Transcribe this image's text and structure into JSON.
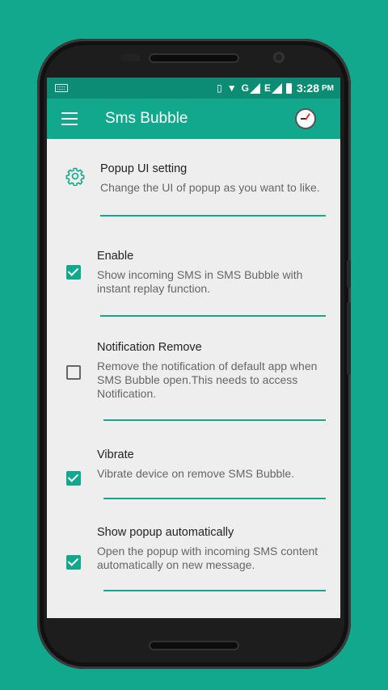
{
  "status_bar": {
    "time": "3:28",
    "ampm": "PM",
    "network_g": "G",
    "network_e": "E",
    "icons": [
      "keyboard-icon",
      "vibrate-icon",
      "wifi-icon",
      "signal-icon",
      "battery-icon"
    ]
  },
  "app_bar": {
    "title": "Sms Bubble",
    "menu_icon": "hamburger-menu-icon",
    "action_icon": "clock-icon"
  },
  "settings": {
    "popup_ui": {
      "title": "Popup UI setting",
      "description": "Change the UI of popup as you want to like.",
      "icon": "gear-icon"
    },
    "enable": {
      "title": "Enable",
      "description": "Show incoming SMS in SMS Bubble with instant replay function.",
      "checked": true
    },
    "notification_remove": {
      "title": "Notification Remove",
      "description": "Remove the notification of default app when SMS Bubble open.This needs to access Notification.",
      "checked": false
    },
    "vibrate": {
      "title": "Vibrate",
      "description": "Vibrate device on remove SMS Bubble.",
      "checked": true
    },
    "show_popup": {
      "title": "Show popup automatically",
      "description": "Open the popup with incoming SMS content automatically on new message.",
      "checked": true
    }
  },
  "colors": {
    "accent": "#11a88d",
    "status_bar": "#0c8c75",
    "background": "#eeeeee"
  }
}
